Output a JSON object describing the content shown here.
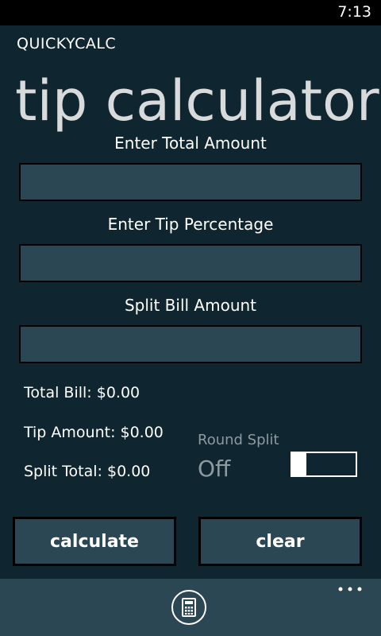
{
  "status_bar": {
    "time": "7:13"
  },
  "app": {
    "name": "QUICKYCALC",
    "page_title": "tip calculator"
  },
  "fields": {
    "total": {
      "label": "Enter Total Amount",
      "value": ""
    },
    "tip": {
      "label": "Enter Tip Percentage",
      "value": ""
    },
    "split": {
      "label": "Split Bill Amount",
      "value": ""
    }
  },
  "results": {
    "total_bill": "Total Bill: $0.00",
    "tip_amount": "Tip Amount: $0.00",
    "split_total": "Split Total: $0.00"
  },
  "round_split": {
    "label": "Round Split",
    "state": "Off",
    "on": false
  },
  "buttons": {
    "calculate": "calculate",
    "clear": "clear"
  },
  "app_bar": {
    "icon": "calculator-icon",
    "more_icon": "more-options-icon"
  },
  "colors": {
    "background": "#0f2530",
    "panel": "#2c4754",
    "muted_text": "#8e9aa0"
  }
}
